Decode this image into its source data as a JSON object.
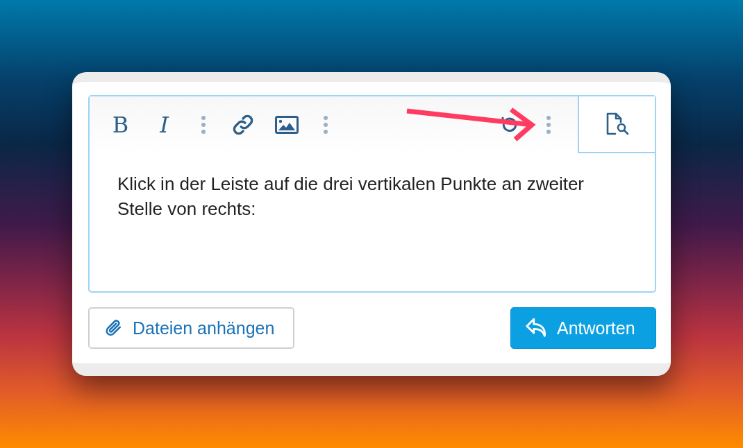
{
  "toolbar": {
    "items": [
      {
        "kind": "bold",
        "label": "B"
      },
      {
        "kind": "italic",
        "label": "I"
      },
      {
        "kind": "more"
      },
      {
        "kind": "link"
      },
      {
        "kind": "image"
      },
      {
        "kind": "more"
      },
      {
        "kind": "spacer"
      },
      {
        "kind": "undo"
      },
      {
        "kind": "more"
      }
    ],
    "preview": {
      "kind": "preview"
    }
  },
  "editor": {
    "text": "Klick in der Leiste auf die drei vertikalen Punkte an zweiter Stelle von rechts:"
  },
  "annotation": {
    "kind": "arrow"
  },
  "buttons": [
    {
      "kind": "attach",
      "label": "Dateien anhängen"
    },
    {
      "kind": "reply",
      "label": "Antworten"
    }
  ]
}
